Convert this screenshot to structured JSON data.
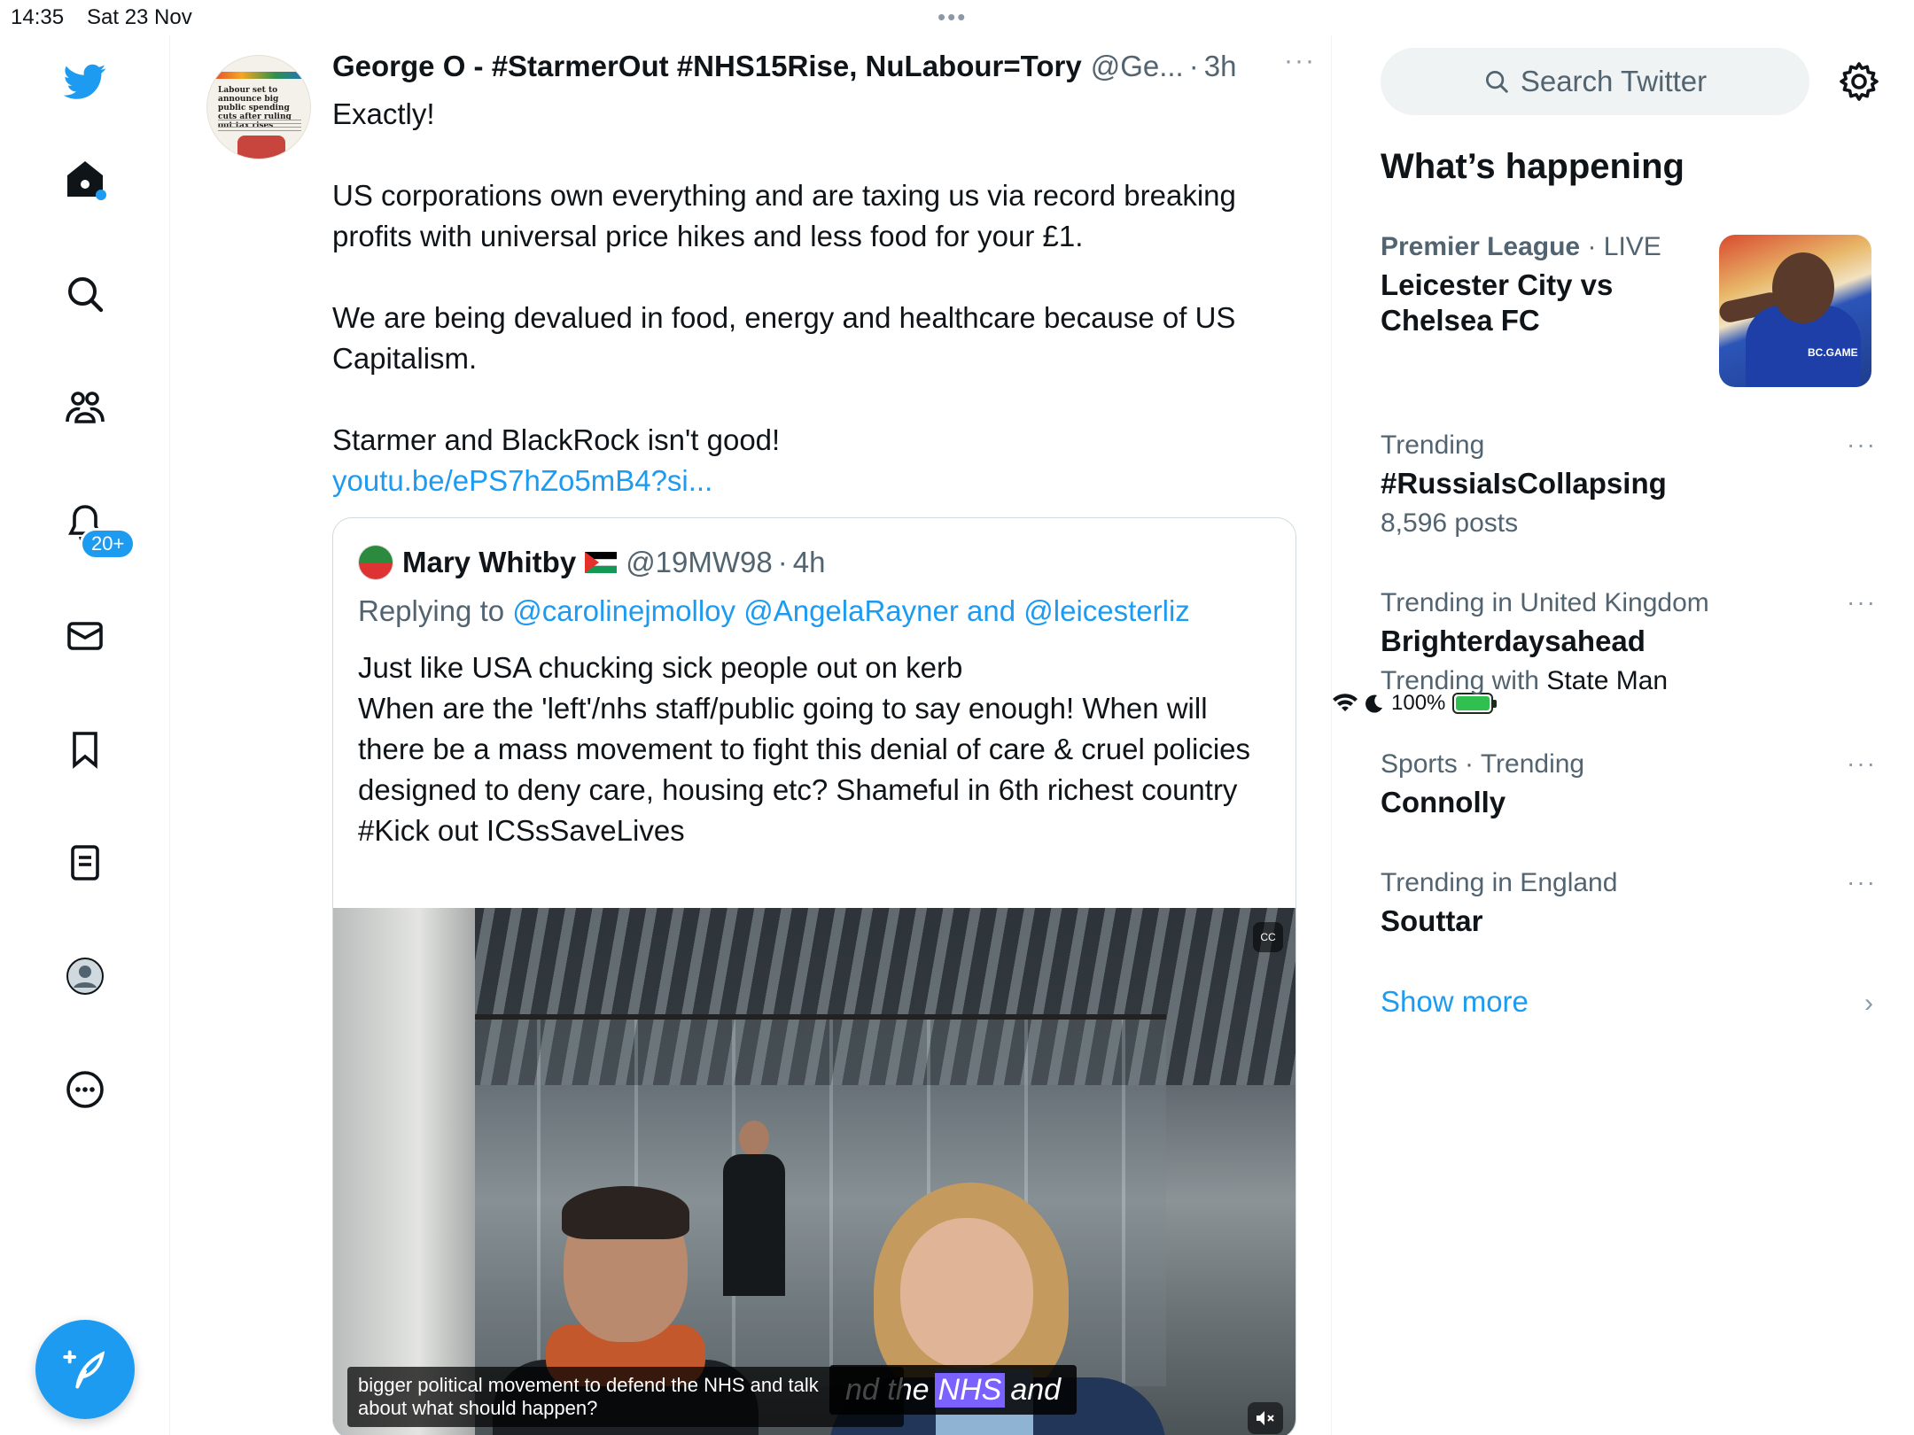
{
  "status": {
    "time": "14:35",
    "date": "Sat 23 Nov",
    "battery": "100%"
  },
  "nav": {
    "notifications_badge": "20+",
    "accent": "#1d9bf0"
  },
  "tweet": {
    "author_name": "George O - #StarmerOut #NHS15Rise, NuLabour=Tory",
    "author_handle": "@Ge...",
    "time": "3h",
    "more": "···",
    "lines": [
      "Exactly!",
      "US corporations own everything and are taxing us via record breaking profits with universal price hikes and less food for your £1.",
      "We are being devalued in food, energy and healthcare because of US Capitalism.",
      "Starmer and BlackRock isn't good!"
    ],
    "link": "youtu.be/ePS7hZo5mB4?si..."
  },
  "quote": {
    "author_name": "Mary Whitby",
    "author_handle": "@19MW98",
    "time": "4h",
    "replying_prefix": "Replying to",
    "mention1": "@carolinejmolloy",
    "mention2": "@AngelaRayner",
    "and": "and",
    "mention3": "@leicesterliz",
    "lines": [
      "Just like USA chucking sick people out on kerb",
      "When are the 'left'/nhs staff/public going to say enough! When will there be a mass movement to fight this denial of care & cruel policies designed to deny care, housing etc?  Shameful in 6th richest country",
      "#Kick out ICSsSaveLives"
    ],
    "video": {
      "caption_line1": "bigger political movement to defend the NHS and talk",
      "caption_line2": "about what should happen?",
      "burned_pre": "nd the",
      "burned_highlight": "NHS",
      "burned_post": "and",
      "cc": "CC"
    }
  },
  "sidebar": {
    "search_placeholder": "Search Twitter",
    "heading": "What’s happening",
    "trends": [
      {
        "meta_bold": "Premier League",
        "meta": " · LIVE",
        "title": "Leicester City vs Chelsea FC",
        "sub": ""
      },
      {
        "meta": "Trending",
        "title": "#RussiaIsCollapsing",
        "sub": "8,596 posts"
      },
      {
        "meta": "Trending in United Kingdom",
        "title": "Brighterdaysahead",
        "sub_prefix": "Trending with",
        "sub_name": "State Man"
      },
      {
        "meta": "Sports · Trending",
        "title": "Connolly",
        "sub": ""
      },
      {
        "meta": "Trending in England",
        "title": "Souttar",
        "sub": ""
      }
    ],
    "trend_more": "···",
    "show_more": "Show more",
    "image_logo": "BC.GAME"
  }
}
